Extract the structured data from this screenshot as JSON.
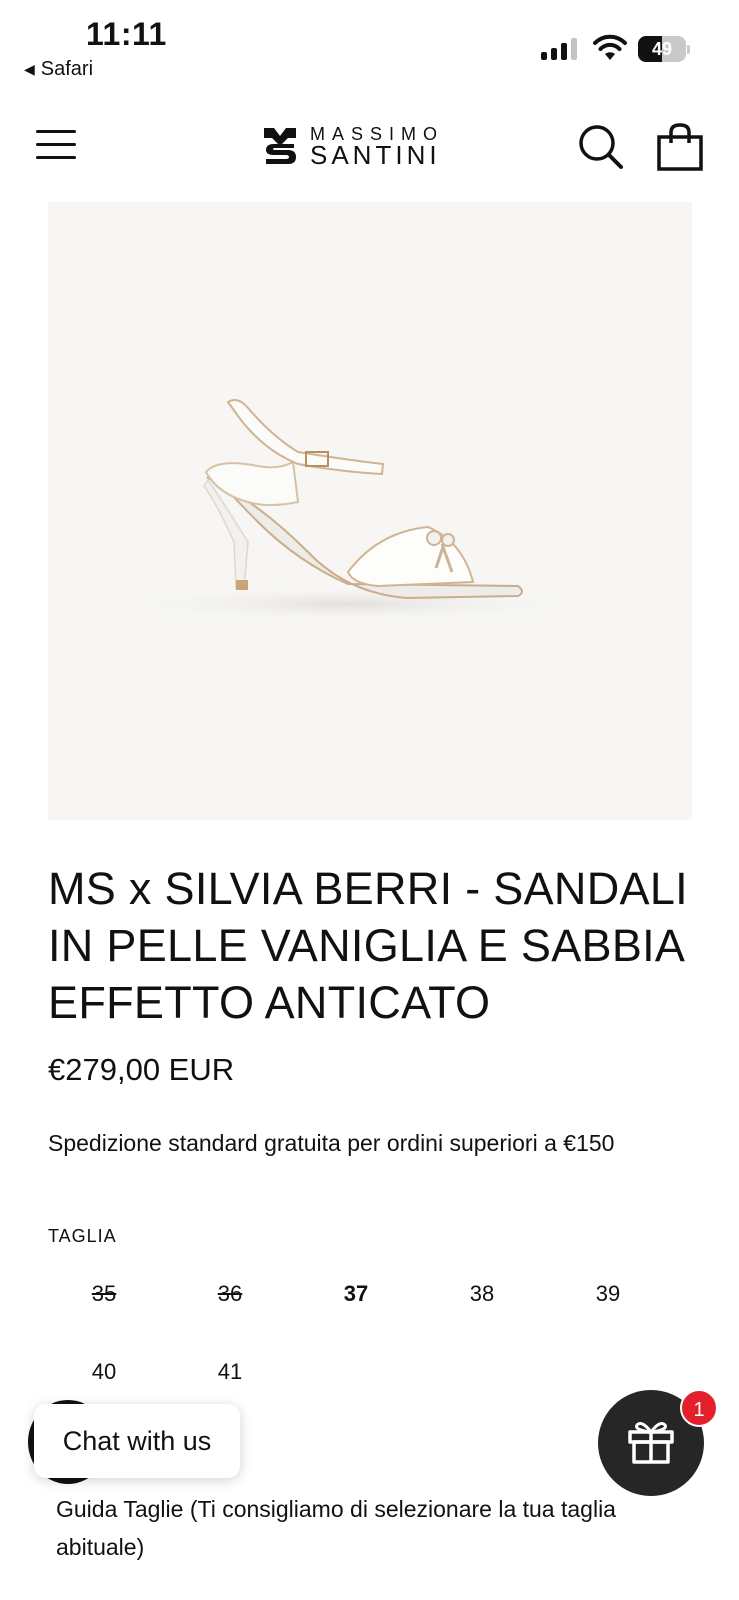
{
  "status_bar": {
    "time": "11:11",
    "back_app": "Safari",
    "battery_pct": "49",
    "battery_level": 0.49,
    "signal_bars": 4,
    "signal_active": 3
  },
  "header": {
    "logo_line1": "MASSIMO",
    "logo_line2": "SANTINI",
    "menu_icon": "hamburger-icon",
    "search_icon": "search-icon",
    "cart_icon": "shopping-bag-icon"
  },
  "product": {
    "image_alt": "sandal",
    "title": "MS x SILVIA BERRI - SANDALI IN PELLE VANIGLIA E SABBIA EFFETTO ANTICATO",
    "price": "€279,00 EUR",
    "shipping_note": "Spedizione standard gratuita per ordini superiori a €150",
    "size_label": "TAGLIA",
    "sizes": [
      {
        "label": "35",
        "status": "soldout"
      },
      {
        "label": "36",
        "status": "soldout"
      },
      {
        "label": "37",
        "status": "selected"
      },
      {
        "label": "38",
        "status": "available"
      },
      {
        "label": "39",
        "status": "available"
      },
      {
        "label": "40",
        "status": "available"
      },
      {
        "label": "41",
        "status": "available"
      }
    ],
    "size_guide": "Guida Taglie (Ti consigliamo di selezionare la tua taglia abituale)"
  },
  "widgets": {
    "chat_label": "Chat with us",
    "gift_icon": "gift-icon",
    "gift_badge": "1"
  },
  "colors": {
    "image_bg": "#f7f6f4",
    "gift_bg": "#262626",
    "badge_red": "#e3202b"
  }
}
